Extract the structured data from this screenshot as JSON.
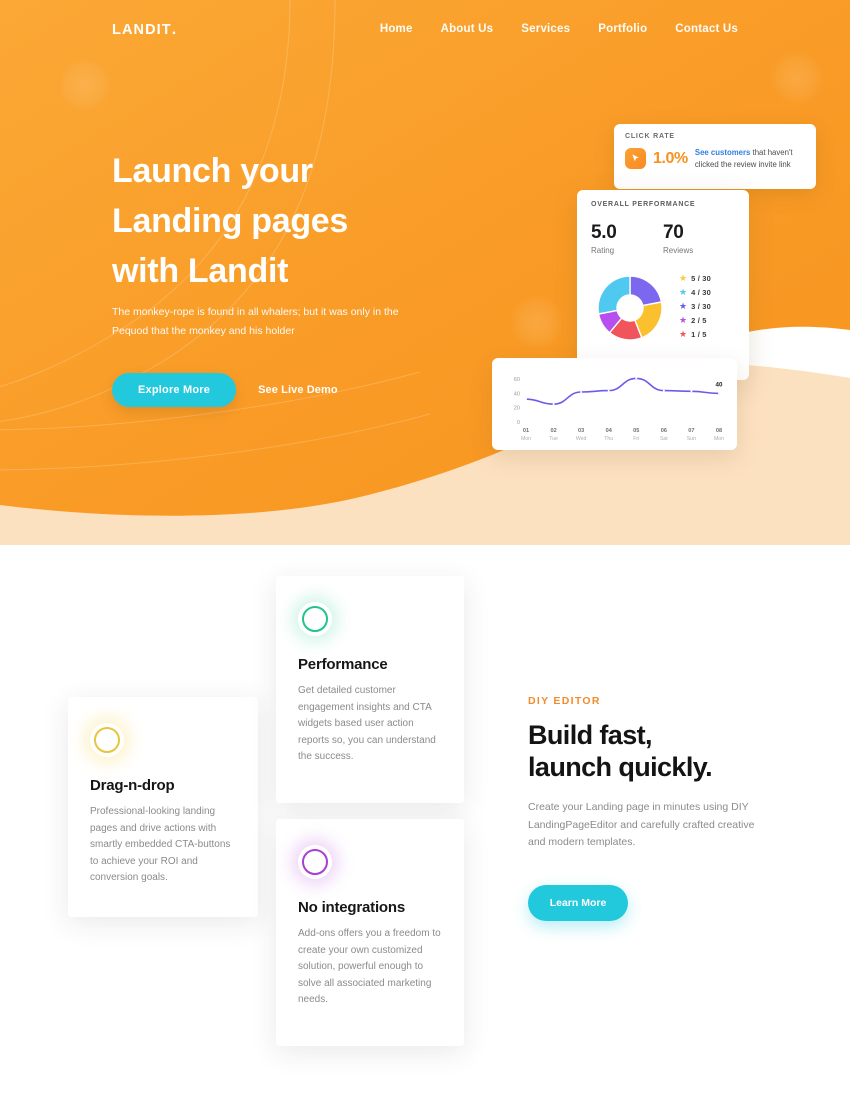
{
  "brand": {
    "name": "LANDIT",
    "dot": "."
  },
  "nav": {
    "items": [
      {
        "label": "Home"
      },
      {
        "label": "About Us"
      },
      {
        "label": "Services"
      },
      {
        "label": "Portfolio"
      },
      {
        "label": "Contact Us"
      }
    ]
  },
  "hero": {
    "title_line1": "Launch your",
    "title_line2": "Landing pages",
    "title_line3": "with Landit",
    "subtitle": "The monkey-rope is found in all whalers; but it was only in the Pequod that the monkey and his holder",
    "primary_button": "Explore More",
    "secondary_link": "See Live Demo",
    "bg_color": "#f9a02c",
    "accent_color": "#22c9dd"
  },
  "click_rate_card": {
    "label": "CLICK RATE",
    "value": "1.0%",
    "icon": "cursor-click-icon",
    "link_text": "See customers",
    "rest_text": " that haven't clicked the review invite link",
    "value_color": "#f6921e"
  },
  "performance_card": {
    "label": "OVERALL PERFORMANCE",
    "stats": [
      {
        "value": "5.0",
        "caption": "Rating"
      },
      {
        "value": "70",
        "caption": "Reviews"
      }
    ],
    "star_rows": [
      {
        "label": "5 / 30",
        "color": "#ffc83d"
      },
      {
        "label": "4 / 30",
        "color": "#4fc9f0"
      },
      {
        "label": "3 / 30",
        "color": "#6b5ce7"
      },
      {
        "label": "2 / 5",
        "color": "#b74ef0"
      },
      {
        "label": "1 / 5",
        "color": "#f2545b"
      }
    ],
    "donut": {
      "segments": [
        {
          "name": "5 stars",
          "color": "#7b68ee",
          "value": 22
        },
        {
          "name": "4 stars",
          "color": "#fbc02d",
          "value": 22
        },
        {
          "name": "3 stars",
          "color": "#f2545b",
          "value": 17
        },
        {
          "name": "2 stars",
          "color": "#b74ef0",
          "value": 11
        },
        {
          "name": "1 star",
          "color": "#4fc9f0",
          "value": 28
        }
      ]
    }
  },
  "chart_data": {
    "type": "line",
    "title": "",
    "xlabel": "",
    "ylabel": "",
    "categories": [
      "01",
      "02",
      "03",
      "04",
      "05",
      "06",
      "07",
      "08"
    ],
    "tick_sublabels": [
      "Mon",
      "Tue",
      "Wed",
      "Thu",
      "Fri",
      "Sat",
      "Sun",
      "Mon"
    ],
    "values": [
      32,
      25,
      42,
      44,
      61,
      44,
      43,
      40
    ],
    "yticks": [
      "0",
      "20",
      "40",
      "60"
    ],
    "ylim": [
      0,
      70
    ],
    "grid": false,
    "legend": "none",
    "annotation": {
      "label": "40",
      "at_category": "08"
    },
    "line_color": "#6b5ce7"
  },
  "features": [
    {
      "id": "drag-n-drop",
      "title": "Drag-n-drop",
      "text": "Professional-looking landing pages and drive actions with smartly embedded CTA-buttons to achieve your ROI and conversion goals.",
      "icon": "circle-ring-icon",
      "icon_color": "#e8c53a",
      "icon_glow": "rgba(248,216,80,0.30)"
    },
    {
      "id": "performance",
      "title": "Performance",
      "text": "Get detailed customer engagement insights and CTA widgets based user action reports so, you can understand the success.",
      "icon": "circle-ring-icon",
      "icon_color": "#22c48e",
      "icon_glow": "rgba(46,204,150,0.22)"
    },
    {
      "id": "no-integrations",
      "title": "No integrations",
      "text": "Add-ons offers you a freedom to create your own customized solution, powerful enough to solve all associated marketing needs.",
      "icon": "circle-ring-icon",
      "icon_color": "#a93ed4",
      "icon_glow": "rgba(186,85,228,0.25)"
    }
  ],
  "editor_section": {
    "eyebrow": "DIY EDITOR",
    "title_line1": "Build fast,",
    "title_line2": "launch quickly.",
    "body": "Create your Landing page in minutes using DIY LandingPageEditor and carefully crafted creative and modern templates.",
    "button": "Learn More"
  }
}
